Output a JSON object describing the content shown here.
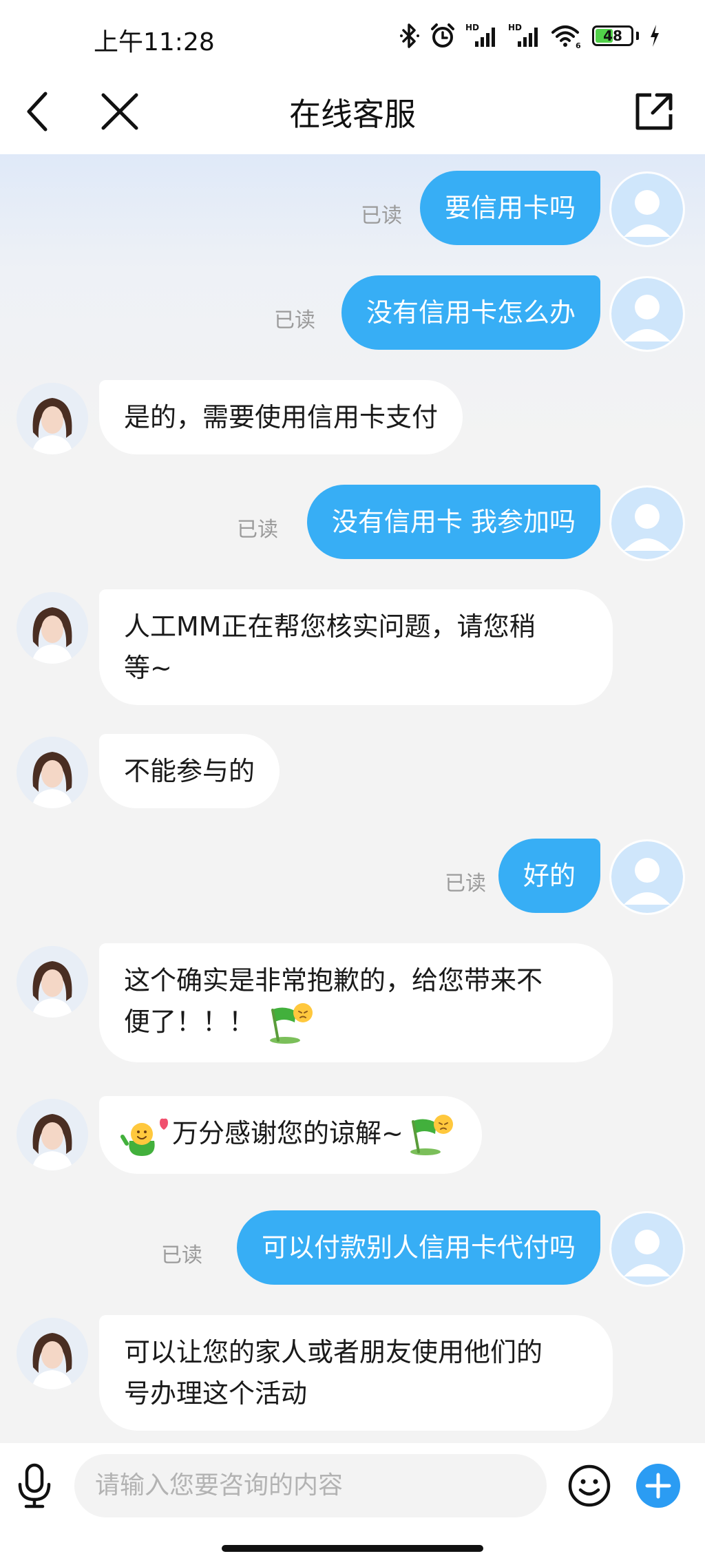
{
  "status_bar": {
    "time": "上午11:28",
    "battery": "48",
    "signal_label": "HD"
  },
  "nav": {
    "title": "在线客服",
    "back_icon": "chevron-left-icon",
    "close_icon": "close-icon",
    "share_icon": "share-external-icon"
  },
  "messages": [
    {
      "side": "out",
      "text": "要信用卡吗",
      "status": "已读"
    },
    {
      "side": "out",
      "text": "没有信用卡怎么办",
      "status": "已读"
    },
    {
      "side": "in",
      "text": "是的，需要使用信用卡支付"
    },
    {
      "side": "out",
      "text": "没有信用卡 我参加吗",
      "status": "已读"
    },
    {
      "side": "in",
      "line1": "人工MM正在帮您核实问题，请您稍",
      "line2": "等~"
    },
    {
      "side": "in",
      "text": "不能参与的"
    },
    {
      "side": "out",
      "text": "好的",
      "status": "已读"
    },
    {
      "side": "in",
      "line1": "这个确实是非常抱歉的，给您带来不",
      "line2": "便了！！！",
      "emoji": "sorry-flag-emoji"
    },
    {
      "side": "in",
      "text": "万分感谢您的谅解~",
      "emoji_before": "love-wave-emoji",
      "emoji_after": "sorry-flag-emoji"
    },
    {
      "side": "out",
      "text": "可以付款别人信用卡代付吗",
      "status": "已读"
    },
    {
      "side": "in",
      "line1": "可以让您的家人或者朋友使用他们的",
      "line2": "号办理这个活动"
    }
  ],
  "input": {
    "placeholder": "请输入您要咨询的内容",
    "voice_icon": "microphone-icon",
    "emoji_icon": "smiley-icon",
    "add_icon": "plus-icon"
  },
  "colors": {
    "outgoing_bubble": "#37aef5",
    "incoming_bubble": "#ffffff",
    "background": "#f3f3f3",
    "read_label": "#9b9b9b",
    "add_button": "#2b9cf3"
  }
}
